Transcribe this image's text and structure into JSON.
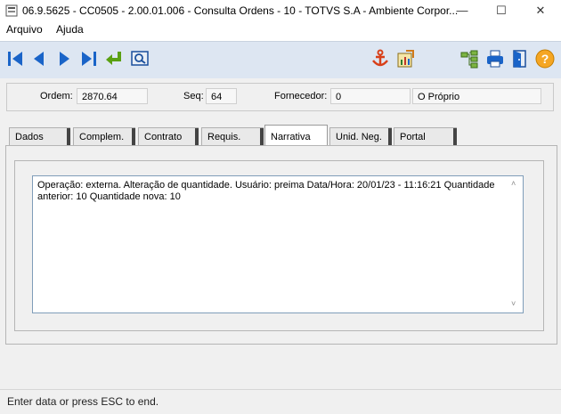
{
  "window": {
    "title": "06.9.5625 - CC0505 - 2.00.01.006 - Consulta Ordens - 10 - TOTVS S.A - Ambiente Corpor...",
    "minimize": "—",
    "maximize": "☐",
    "close": "✕"
  },
  "menu": {
    "items": [
      "Arquivo",
      "Ajuda"
    ]
  },
  "toolbar": {
    "icons": [
      "first-record-icon",
      "previous-record-icon",
      "next-record-icon",
      "last-record-icon",
      "return-icon",
      "search-icon",
      "anchor-icon",
      "report-icon",
      "hierarchy-icon",
      "print-icon",
      "exit-door-icon",
      "help-icon"
    ],
    "accent": "#dde6f2"
  },
  "header": {
    "ordem_label": "Ordem:",
    "ordem_value": "2870.64",
    "seq_label": "Seq:",
    "seq_value": "64",
    "fornecedor_label": "Fornecedor:",
    "fornecedor_code": "0",
    "fornecedor_name": "O Próprio"
  },
  "tabs": [
    "Dados",
    "Complem.",
    "Contrato",
    "Requis.",
    "Narrativa",
    "Unid. Neg.",
    "Portal"
  ],
  "active_tab": "Narrativa",
  "narrativa": {
    "text": "Operação: externa. Alteração de quantidade. Usuário: preima Data/Hora: 20/01/23 - 11:16:21 Quantidade anterior: 10 Quantidade nova: 10"
  },
  "status": {
    "message": "Enter data or press ESC to end."
  }
}
